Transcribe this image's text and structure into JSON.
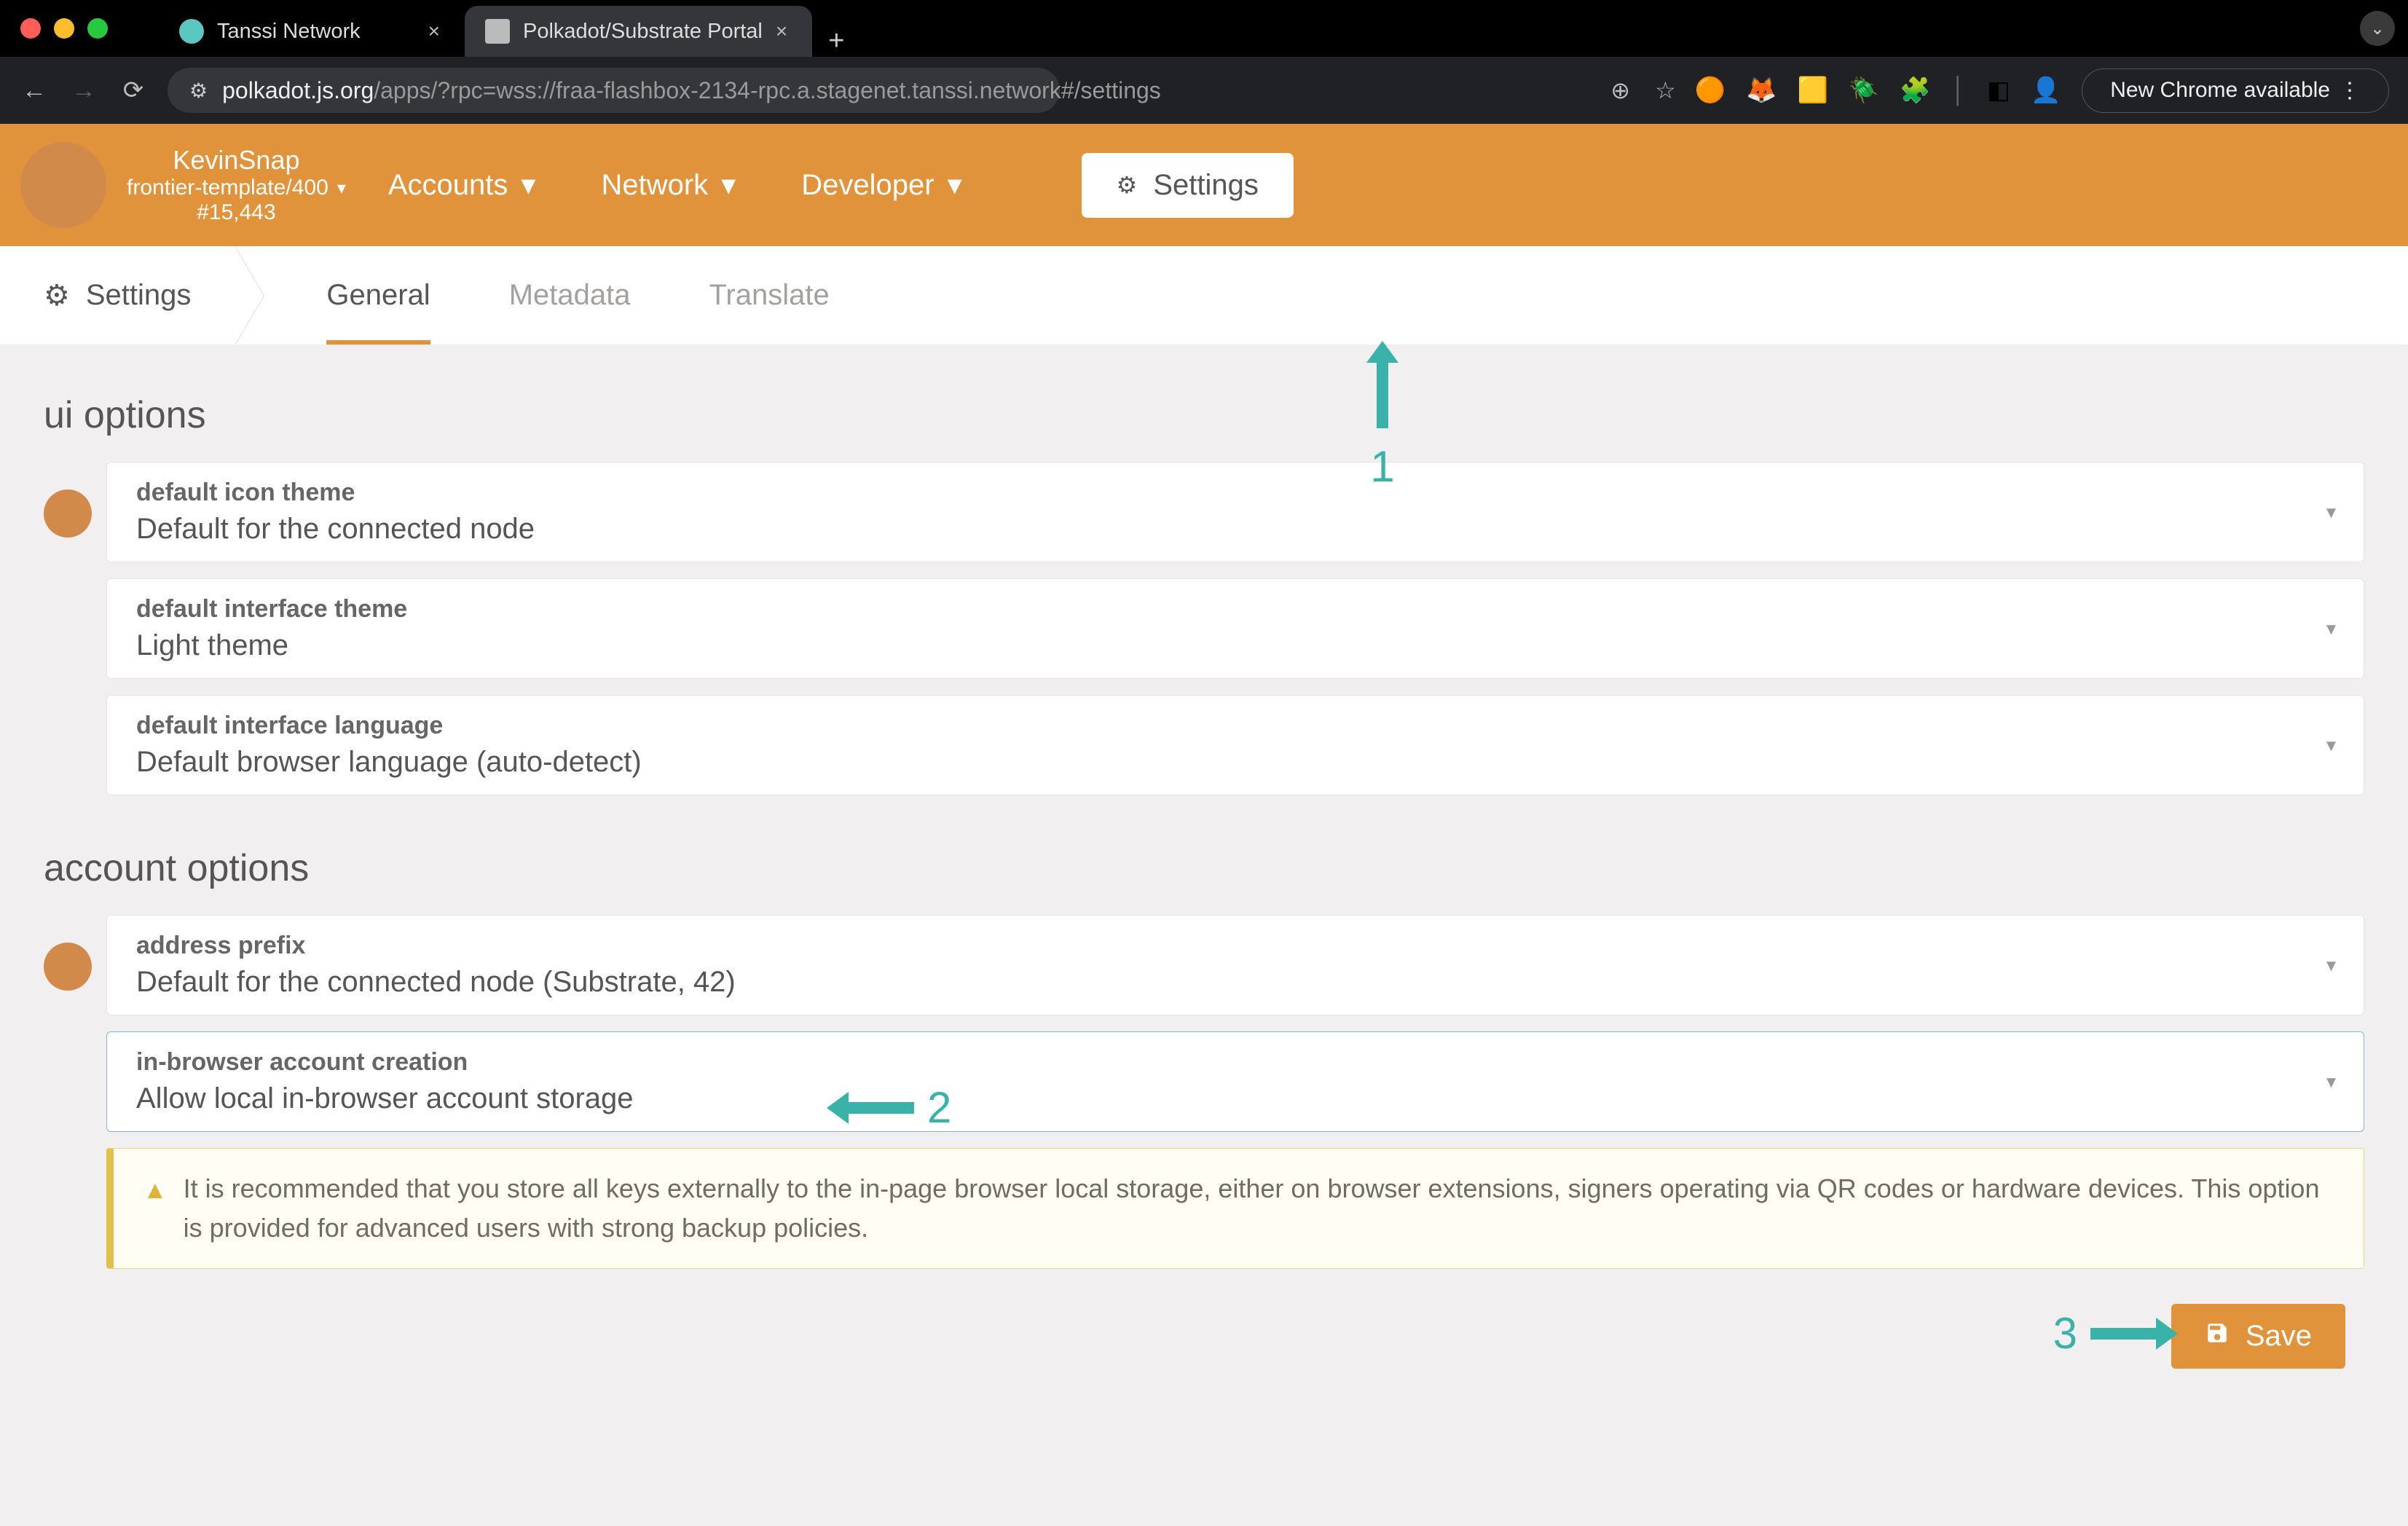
{
  "browser": {
    "tabs": [
      {
        "title": "Tanssi Network"
      },
      {
        "title": "Polkadot/Substrate Portal"
      }
    ],
    "close_glyph": "×",
    "new_tab_glyph": "+",
    "url_main": "polkadot.js.org",
    "url_path": "/apps/?rpc=wss://fraa-flashbox-2134-rpc.a.stagenet.tanssi.network#/settings",
    "star_glyph": "☆",
    "zoom_glyph": "⊕",
    "back_glyph": "←",
    "forward_glyph": "→",
    "reload_glyph": "⟳",
    "dropdown_glyph": "⌄",
    "chrome_button": "New Chrome available",
    "chrome_menu": "⋮"
  },
  "appbar": {
    "chain_name": "KevinSnap",
    "chain_sub": "frontier-template/400",
    "block": "#15,443",
    "nav": {
      "accounts": "Accounts",
      "network": "Network",
      "developer": "Developer",
      "settings": "Settings"
    },
    "caret": "▾",
    "gear": "⚙"
  },
  "subnav": {
    "root": "Settings",
    "tabs": {
      "general": "General",
      "metadata": "Metadata",
      "translate": "Translate"
    },
    "gear": "⚙"
  },
  "ui_options": {
    "heading": "ui options",
    "icon_theme": {
      "label": "default icon theme",
      "value": "Default for the connected node"
    },
    "interface_theme": {
      "label": "default interface theme",
      "value": "Light theme"
    },
    "language": {
      "label": "default interface language",
      "value": "Default browser language (auto-detect)"
    }
  },
  "account_options": {
    "heading": "account options",
    "prefix": {
      "label": "address prefix",
      "value": "Default for the connected node (Substrate, 42)"
    },
    "creation": {
      "label": "in-browser account creation",
      "value": "Allow local in-browser account storage"
    },
    "warning": "It is recommended that you store all keys externally to the in-page browser local storage, either on browser extensions, signers operating via QR codes or hardware devices. This option is provided for advanced users with strong backup policies."
  },
  "save_label": "Save",
  "caret_down": "▾",
  "warn_icon": "▲",
  "save_icon": "💾",
  "annotations": {
    "n1": "1",
    "n2": "2",
    "n3": "3"
  },
  "colors": {
    "accent": "#e1933c",
    "teal": "#39b3aa"
  }
}
